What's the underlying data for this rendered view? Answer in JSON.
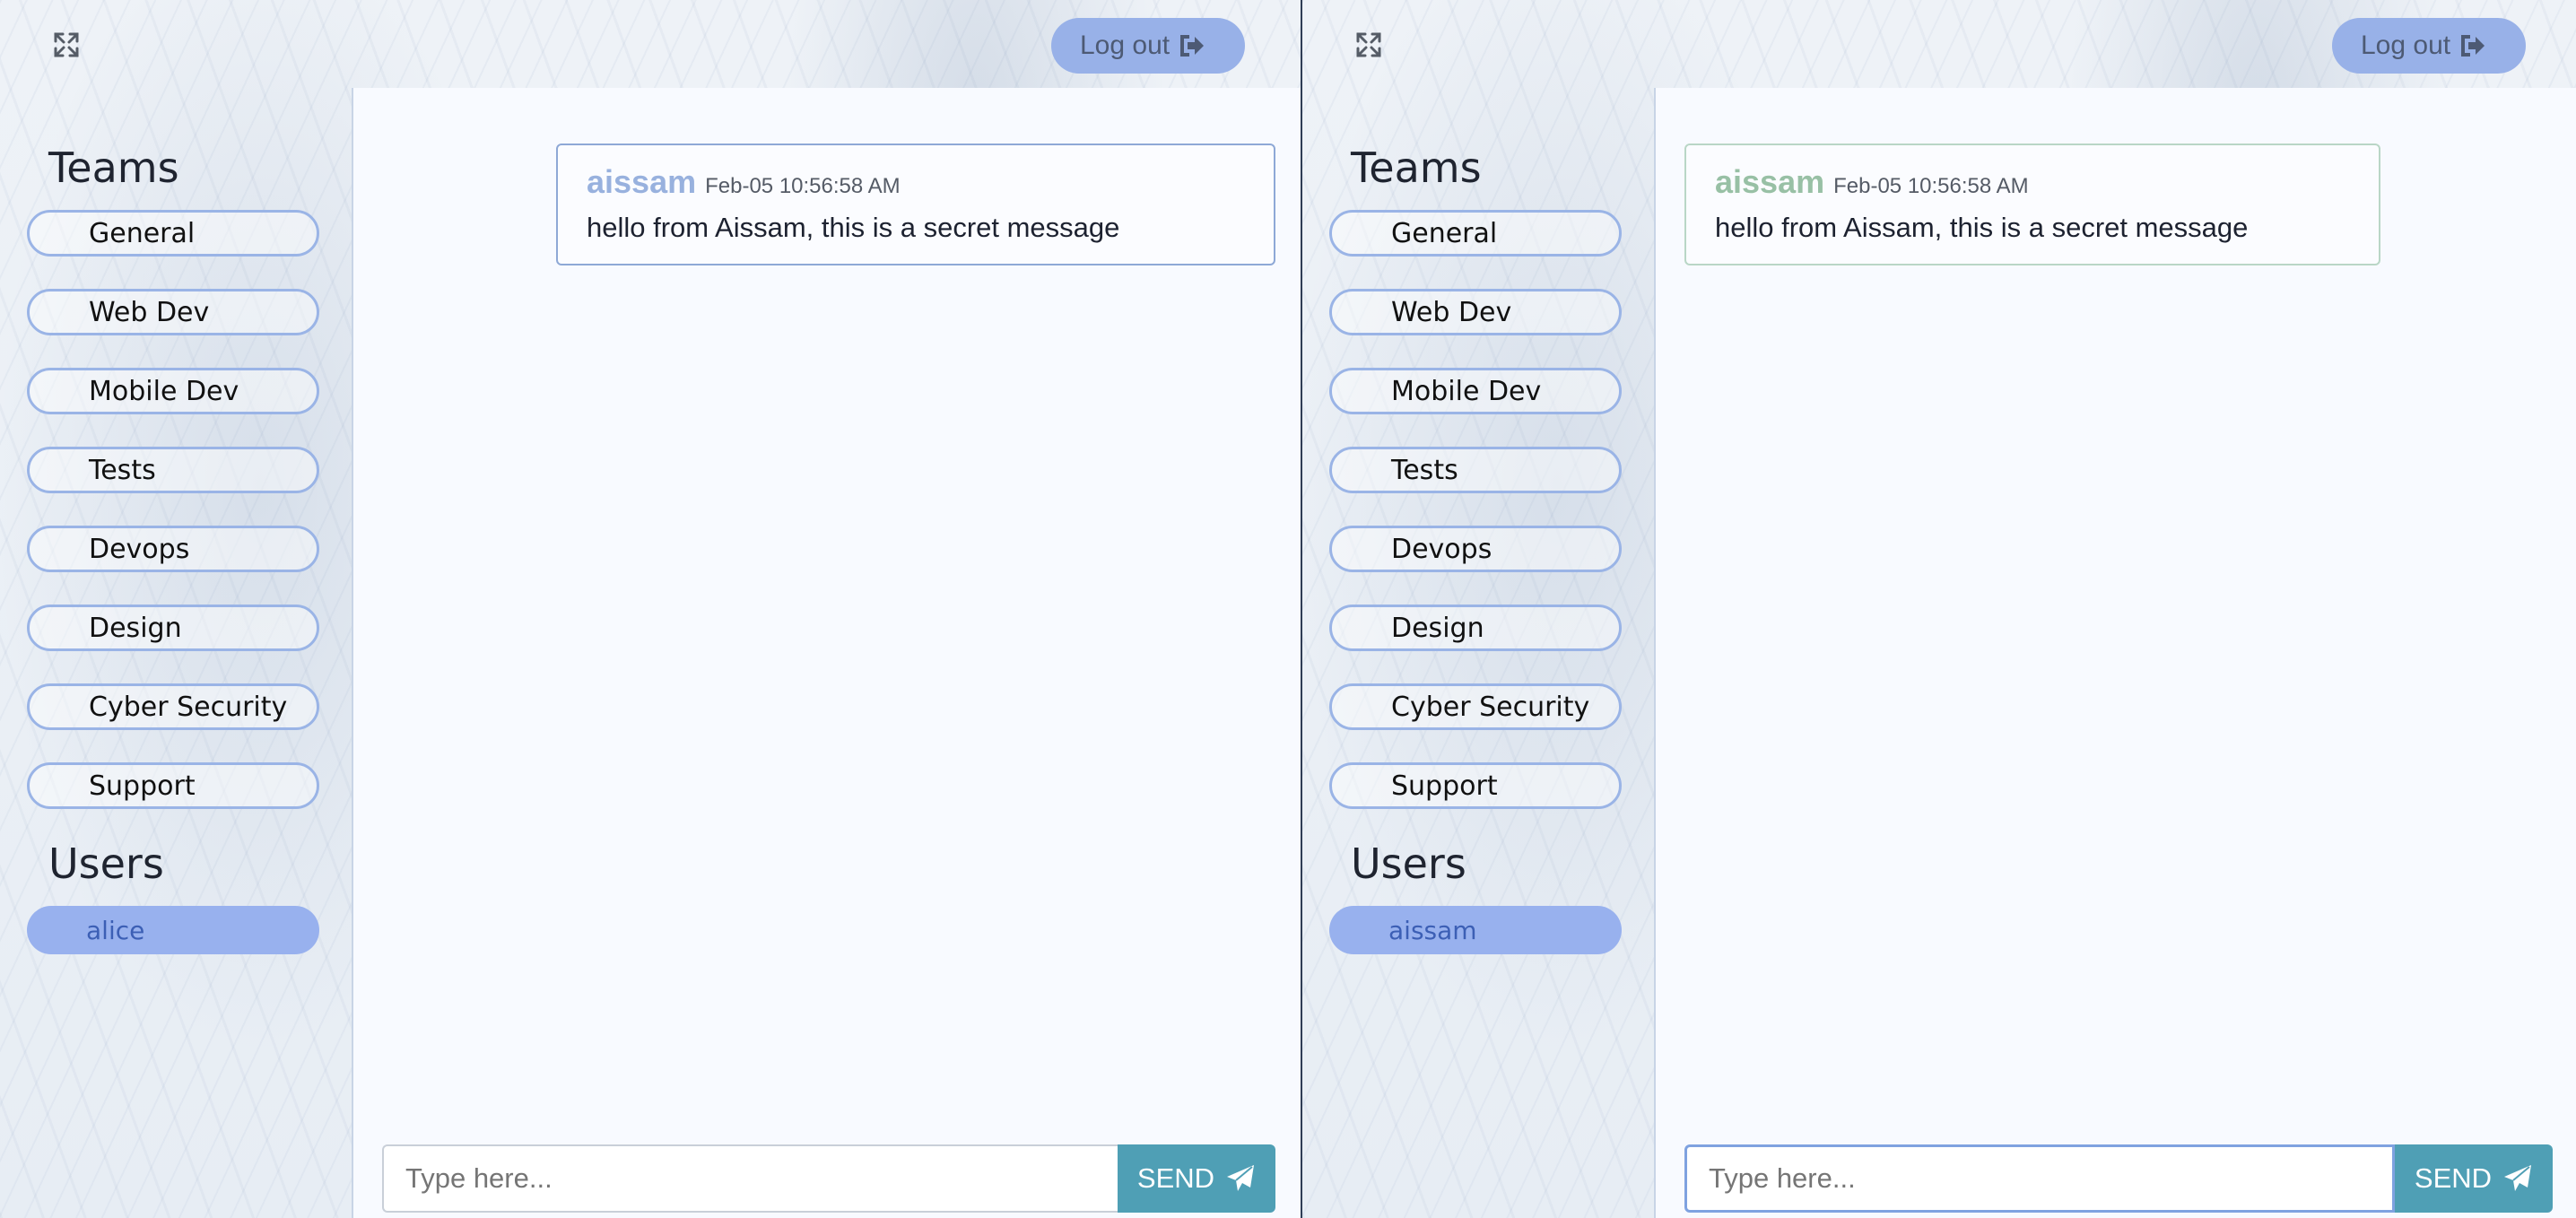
{
  "left": {
    "logout_label": "Log out",
    "teams_title": "Teams",
    "teams": [
      "General",
      "Web Dev",
      "Mobile Dev",
      "Tests",
      "Devops",
      "Design",
      "Cyber Security",
      "Support"
    ],
    "users_title": "Users",
    "users": [
      "alice"
    ],
    "message": {
      "user": "aissam",
      "time": "Feb-05 10:56:58 AM",
      "text": "hello from Aissam, this is a secret message"
    },
    "input_placeholder": "Type here...",
    "send_label": "SEND"
  },
  "right": {
    "logout_label": "Log out",
    "teams_title": "Teams",
    "teams": [
      "General",
      "Web Dev",
      "Mobile Dev",
      "Tests",
      "Devops",
      "Design",
      "Cyber Security",
      "Support"
    ],
    "users_title": "Users",
    "users": [
      "aissam"
    ],
    "message": {
      "user": "aissam",
      "time": "Feb-05 10:56:58 AM",
      "text": "hello from Aissam, this is a secret message"
    },
    "input_placeholder": "Type here...",
    "send_label": "SEND"
  },
  "icons": {
    "expand": "expand-icon",
    "logout": "logout-icon",
    "send": "paper-plane-icon"
  },
  "colors": {
    "accent": "#98b1e8",
    "send": "#4f9fb5",
    "user_left": "#98b1de",
    "user_right": "#98c0a5"
  }
}
